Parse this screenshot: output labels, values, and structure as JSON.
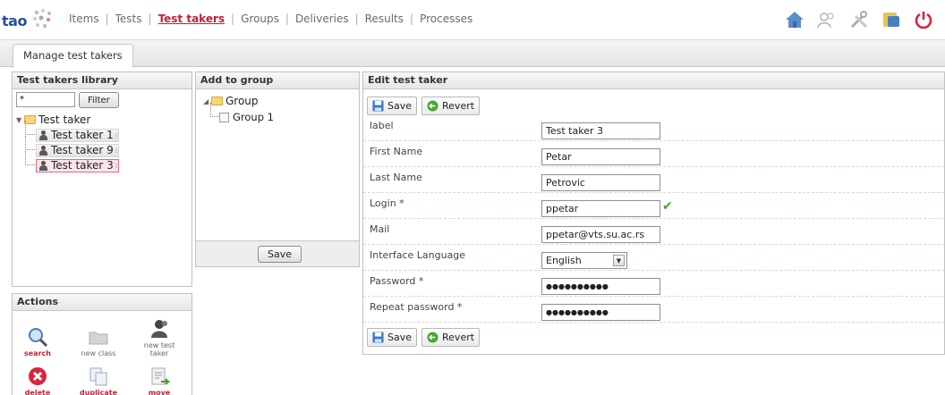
{
  "app": {
    "logo_text": "tao"
  },
  "nav": {
    "items": [
      {
        "label": "Items"
      },
      {
        "label": "Tests"
      },
      {
        "label": "Test takers"
      },
      {
        "label": "Groups"
      },
      {
        "label": "Deliveries"
      },
      {
        "label": "Results"
      },
      {
        "label": "Processes"
      }
    ],
    "active_index": 2
  },
  "top_icons": [
    "home-icon",
    "users-icon",
    "tools-icon",
    "extensions-icon",
    "logout-icon"
  ],
  "tab": {
    "label": "Manage test takers"
  },
  "library": {
    "title": "Test takers library",
    "filter_value": "*",
    "filter_button": "Filter",
    "root": "Test taker",
    "items": [
      {
        "label": "Test taker 1"
      },
      {
        "label": "Test taker 9"
      },
      {
        "label": "Test taker 3"
      }
    ],
    "selected_index": 2
  },
  "actions": {
    "title": "Actions",
    "items": [
      {
        "label": "search",
        "icon": "search-icon"
      },
      {
        "label": "new class",
        "icon": "folder-icon"
      },
      {
        "label": "new test taker",
        "icon": "new-test-taker-icon"
      },
      {
        "label": "delete",
        "icon": "delete-icon"
      },
      {
        "label": "duplicate",
        "icon": "duplicate-icon"
      },
      {
        "label": "move",
        "icon": "move-icon"
      }
    ]
  },
  "add_group": {
    "title": "Add to group",
    "root": "Group",
    "items": [
      {
        "label": "Group 1",
        "checked": false
      }
    ],
    "save_label": "Save"
  },
  "edit": {
    "title": "Edit test taker",
    "save_label": "Save",
    "revert_label": "Revert",
    "fields": {
      "label": {
        "label": "label",
        "value": "Test taker 3"
      },
      "first_name": {
        "label": "First Name",
        "value": "Petar"
      },
      "last_name": {
        "label": "Last Name",
        "value": "Petrovic"
      },
      "login": {
        "label": "Login *",
        "value": "ppetar"
      },
      "mail": {
        "label": "Mail",
        "value": "ppetar@vts.su.ac.rs"
      },
      "language": {
        "label": "Interface Language",
        "value": "English"
      },
      "password": {
        "label": "Password *",
        "value": "●●●●●●●●●●"
      },
      "repeat_password": {
        "label": "Repeat password *",
        "value": "●●●●●●●●●●"
      }
    }
  },
  "colors": {
    "accent": "#c41e3a",
    "brand": "#2a4f9a",
    "valid": "#4aa02c"
  }
}
